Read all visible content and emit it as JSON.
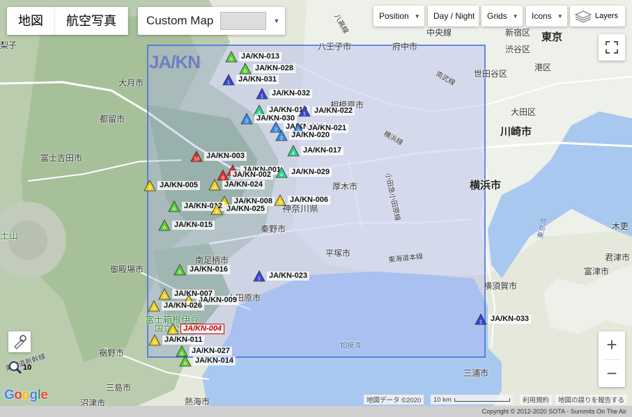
{
  "map_type": {
    "tabs": [
      {
        "label": "地図",
        "active": true
      },
      {
        "label": "航空写真",
        "active": false
      }
    ],
    "custom_label": "Custom Map"
  },
  "toolbar": {
    "position": "Position",
    "day_night": "Day / Night",
    "grids": "Grids",
    "icons": "Icons",
    "layers": "Layers"
  },
  "region_label": "JA/KN",
  "zoom_level": "10",
  "colors": {
    "region_fill": "#aab4f0",
    "region_stroke": "#4169e1",
    "sea": "#a8c8f0",
    "points": {
      "1": "#3b45d9",
      "2": "#3a8de8",
      "3": "#f0d020",
      "4": "#30d090",
      "6": "#5cd030",
      "10": "#e03030",
      "8": "#e03030"
    }
  },
  "summits": [
    {
      "ref": "JA/KN-013",
      "points": "6"
    },
    {
      "ref": "JA/KN-028",
      "points": "6"
    },
    {
      "ref": "JA/KN-031",
      "points": "1"
    },
    {
      "ref": "JA/KN-032",
      "points": "1"
    },
    {
      "ref": "JA/KN-018",
      "points": "4"
    },
    {
      "ref": "JA/KN-022",
      "points": "1"
    },
    {
      "ref": "JA/KN-030",
      "points": "2"
    },
    {
      "ref": "JA/KN-019",
      "points": "2"
    },
    {
      "ref": "JA/KN-021",
      "points": "2"
    },
    {
      "ref": "JA/KN-020",
      "points": "2"
    },
    {
      "ref": "JA/KN-017",
      "points": "4"
    },
    {
      "ref": "JA/KN-003",
      "points": "10"
    },
    {
      "ref": "JA/KN-001",
      "points": "10"
    },
    {
      "ref": "JA/KN-002",
      "points": "8"
    },
    {
      "ref": "JA/KN-029",
      "points": "4"
    },
    {
      "ref": "JA/KN-005",
      "points": "3"
    },
    {
      "ref": "JA/KN-024",
      "points": "3"
    },
    {
      "ref": "JA/KN-008",
      "points": "3"
    },
    {
      "ref": "JA/KN-006",
      "points": "3"
    },
    {
      "ref": "JA/KN-012",
      "points": "6"
    },
    {
      "ref": "JA/KN-025",
      "points": "3"
    },
    {
      "ref": "JA/KN-015",
      "points": "6"
    },
    {
      "ref": "JA/KN-016",
      "points": "6"
    },
    {
      "ref": "JA/KN-023",
      "points": "1"
    },
    {
      "ref": "JA/KN-007",
      "points": "3"
    },
    {
      "ref": "JA/KN-009",
      "points": "3"
    },
    {
      "ref": "JA/KN-026",
      "points": "3"
    },
    {
      "ref": "JA/KN-004",
      "points": "3",
      "selected": true
    },
    {
      "ref": "JA/KN-011",
      "points": "3"
    },
    {
      "ref": "JA/KN-027",
      "points": "6"
    },
    {
      "ref": "JA/KN-014",
      "points": "6"
    },
    {
      "ref": "JA/KN-033",
      "points": "1"
    }
  ],
  "places": {
    "tokyo": "東京",
    "kawasaki": "川崎市",
    "yokohama": "横浜市",
    "hachioji": "八王子市",
    "fuchu": "府中市",
    "sagamihara": "相模原市",
    "atsugi": "厚木市",
    "hadano": "秦野市",
    "hiratsuka": "平塚市",
    "odawara": "小田原市",
    "yokosuka": "横須賀市",
    "miura": "三浦市",
    "minamiashigara": "南足柄市",
    "gotemba": "御殿場市",
    "otsuki": "大月市",
    "tsuru": "都留市",
    "fujiyoshida": "富士吉田市",
    "susono": "裾野市",
    "mishima": "三島市",
    "numazu": "沼津市",
    "atami": "熱海市",
    "setagaya": "世田谷区",
    "shibuya": "渋谷区",
    "minato": "港区",
    "ota": "大田区",
    "shinjuku": "新宿区",
    "chuo": "中央線",
    "kanagawa": "神奈川県",
    "sagami_bay": "相模湾",
    "kimitsu": "君津市",
    "futtsu": "富津市",
    "kisarazu": "木更",
    "hakone": "富士箱根伊豆",
    "hakone2": "国立公園",
    "fuji": "土山",
    "nanbu": "南武線",
    "yokohama_line": "横浜線",
    "odakyu": "小田急小田原線",
    "tokaido": "東海道本線",
    "shinkansen": "東海道新幹線",
    "tokyo_bay": "東京湾",
    "hachiko": "八高線",
    "kiba": "木更",
    "ome": "梨子"
  },
  "attribution": {
    "map_data": "地図データ ©2020",
    "scale": "10 km",
    "terms": "利用規約",
    "report": "地図の誤りを報告する"
  },
  "copyright": "Copyright © 2012-2020 SOTA - Summits On The Air"
}
